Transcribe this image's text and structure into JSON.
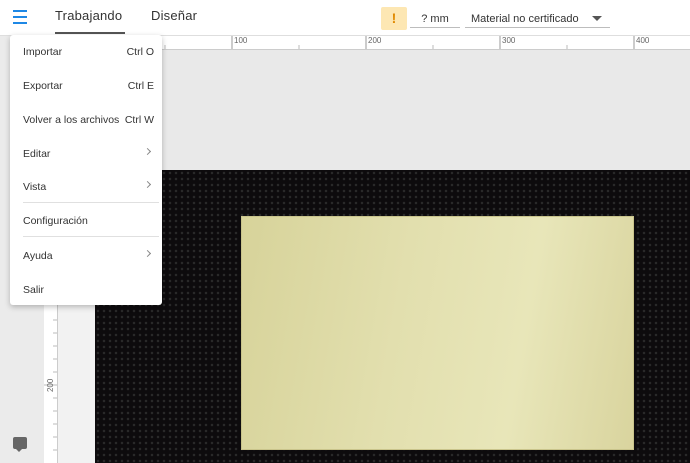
{
  "topbar": {
    "menu_icon": "hamburger-menu-icon",
    "tabs": [
      {
        "label": "Trabajando",
        "active": true
      },
      {
        "label": "Diseñar",
        "active": false
      }
    ],
    "warning_symbol": "!",
    "thickness": "? mm",
    "material": "Material no certificado"
  },
  "ruler": {
    "h_labels": [
      "100",
      "200",
      "300",
      "400"
    ],
    "v_labels": [
      "200"
    ]
  },
  "menu": {
    "items": [
      {
        "label": "Importar",
        "shortcut": "Ctrl O"
      },
      {
        "label": "Exportar",
        "shortcut": "Ctrl E"
      },
      {
        "label": "Volver a los archivos",
        "shortcut": "Ctrl W"
      },
      {
        "label": "Editar",
        "submenu": true
      },
      {
        "label": "Vista",
        "submenu": true
      },
      {
        "label": "Configuración"
      },
      {
        "label": "Ayuda",
        "submenu": true
      },
      {
        "label": "Salir"
      }
    ]
  },
  "colors": {
    "accent": "#1e88e5",
    "warning_bg": "#fde7b3",
    "warning_fg": "#e08a00",
    "material_sheet": "#e2dfae",
    "camera_bg": "#0d0b0d"
  }
}
